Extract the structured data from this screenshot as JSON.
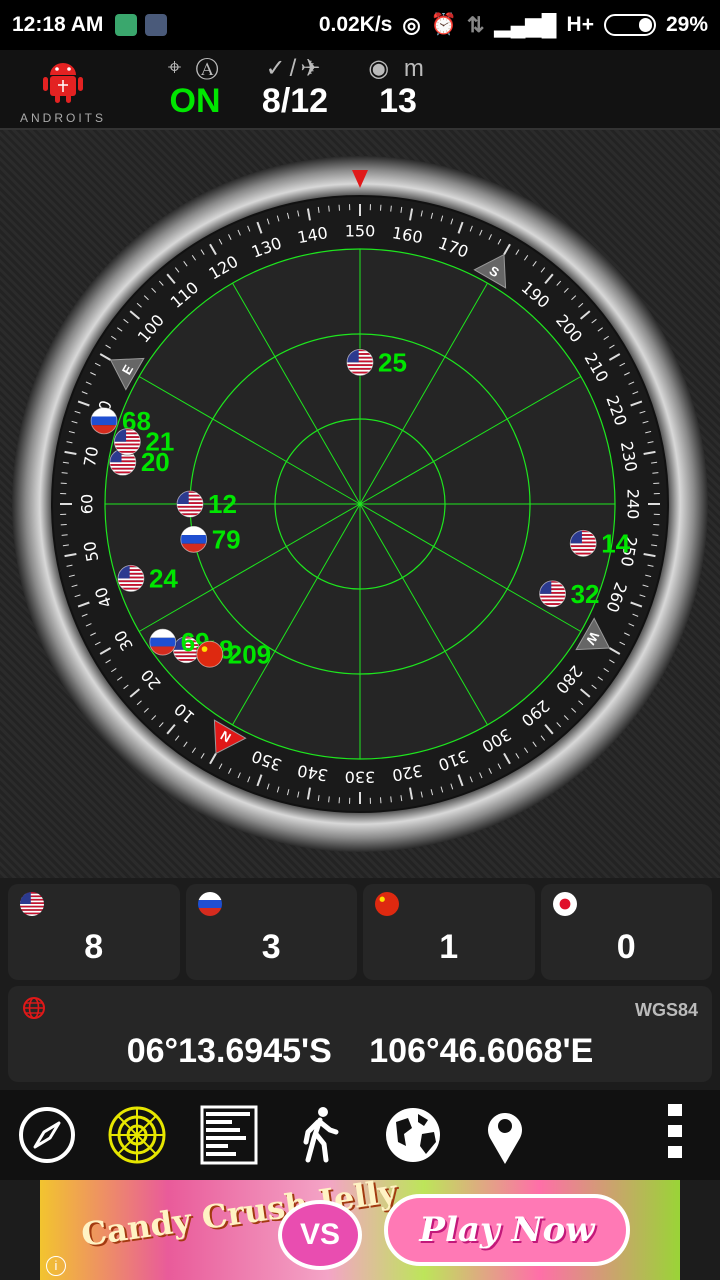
{
  "status_bar": {
    "time": "12:18 AM",
    "net_speed": "0.02K/s",
    "network_type": "H+",
    "battery": "29%",
    "battery_level": 0.29
  },
  "header": {
    "app_logo_text": "ANDROITS",
    "gps_status": "ON",
    "satellites_used": "8",
    "satellites_separator": "/",
    "satellites_total": "12",
    "accuracy_unit": "m",
    "accuracy_value": "13"
  },
  "radar": {
    "direction_labels": {
      "n": "N",
      "e": "E",
      "s": "S",
      "w": "W"
    },
    "satellites": [
      {
        "id": "12",
        "country": "us",
        "azimuth": 60,
        "elevation": 30
      },
      {
        "id": "25",
        "country": "us",
        "azimuth": 150,
        "elevation": 40
      },
      {
        "id": "20",
        "country": "us",
        "azimuth": 70,
        "elevation": 5
      },
      {
        "id": "68",
        "country": "ru",
        "azimuth": 78,
        "elevation": -5
      },
      {
        "id": "79",
        "country": "ru",
        "azimuth": 48,
        "elevation": 30
      },
      {
        "id": "24",
        "country": "us",
        "azimuth": 42,
        "elevation": 5
      },
      {
        "id": "21",
        "country": "us",
        "azimuth": 75,
        "elevation": 5
      },
      {
        "id": "14",
        "country": "us",
        "azimuth": 250,
        "elevation": 10
      },
      {
        "id": "32",
        "country": "us",
        "azimuth": 265,
        "elevation": 15
      },
      {
        "id": "18",
        "country": "us",
        "azimuth": 20,
        "elevation": 10
      },
      {
        "id": "69",
        "country": "ru",
        "azimuth": 25,
        "elevation": 5
      },
      {
        "id": "209",
        "country": "cn",
        "azimuth": 15,
        "elevation": 15
      }
    ]
  },
  "constellation_counts": [
    {
      "country": "us",
      "count": "8"
    },
    {
      "country": "ru",
      "count": "3"
    },
    {
      "country": "cn",
      "count": "1"
    },
    {
      "country": "jp",
      "count": "0"
    }
  ],
  "location": {
    "datum": "WGS84",
    "latitude": "06°13.6945'S",
    "longitude": "106°46.6068'E"
  },
  "nav": [
    {
      "name": "compass",
      "icon": "compass-icon"
    },
    {
      "name": "radar",
      "icon": "radar-icon",
      "active": true
    },
    {
      "name": "signal-bars",
      "icon": "signal-bars-icon"
    },
    {
      "name": "walk",
      "icon": "walk-icon"
    },
    {
      "name": "map",
      "icon": "globe-icon"
    },
    {
      "name": "location",
      "icon": "map-pin-icon"
    },
    {
      "name": "menu",
      "icon": "overflow-menu-icon"
    }
  ],
  "ad": {
    "brand": "Candy Crush Jelly",
    "vs": "VS",
    "cta": "Play Now",
    "info": "i"
  },
  "colors": {
    "accent_green": "#00e600",
    "radar_grid": "#1ee61e",
    "needle_red": "#e01818"
  }
}
